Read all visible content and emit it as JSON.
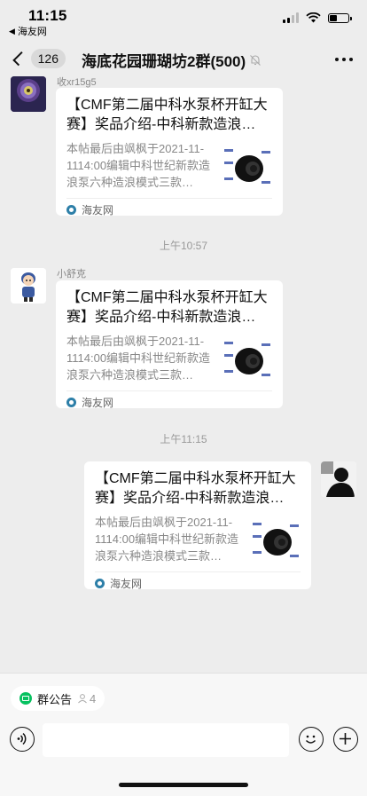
{
  "status_bar": {
    "time": "11:15",
    "back_app": "海友网"
  },
  "nav": {
    "unread_count": "126",
    "title": "海底花园珊瑚坊2群(500)"
  },
  "messages": [
    {
      "sender": "收xr15g5",
      "title": "【CMF第二届中科水泵杯开缸大赛】奖品介绍-中科新款造浪…",
      "desc": "本帖最后由飒枫于2021-11-1114:00编辑中科世纪新款造浪泵六种造浪模式三款…",
      "source": "海友网"
    },
    {
      "sender": "小舒克",
      "title": "【CMF第二届中科水泵杯开缸大赛】奖品介绍-中科新款造浪…",
      "desc": "本帖最后由飒枫于2021-11-1114:00编辑中科世纪新款造浪泵六种造浪模式三款…",
      "source": "海友网"
    },
    {
      "sender": "",
      "title": "【CMF第二届中科水泵杯开缸大赛】奖品介绍-中科新款造浪…",
      "desc": "本帖最后由飒枫于2021-11-1114:00编辑中科世纪新款造浪泵六种造浪模式三款…",
      "source": "海友网"
    }
  ],
  "timestamps": [
    "上午10:57",
    "上午11:15"
  ],
  "bottom": {
    "notice_label": "群公告",
    "notice_count": "4"
  },
  "colors": {
    "background": "#ededed",
    "accent": "#07c160",
    "bubble": "#ffffff"
  }
}
